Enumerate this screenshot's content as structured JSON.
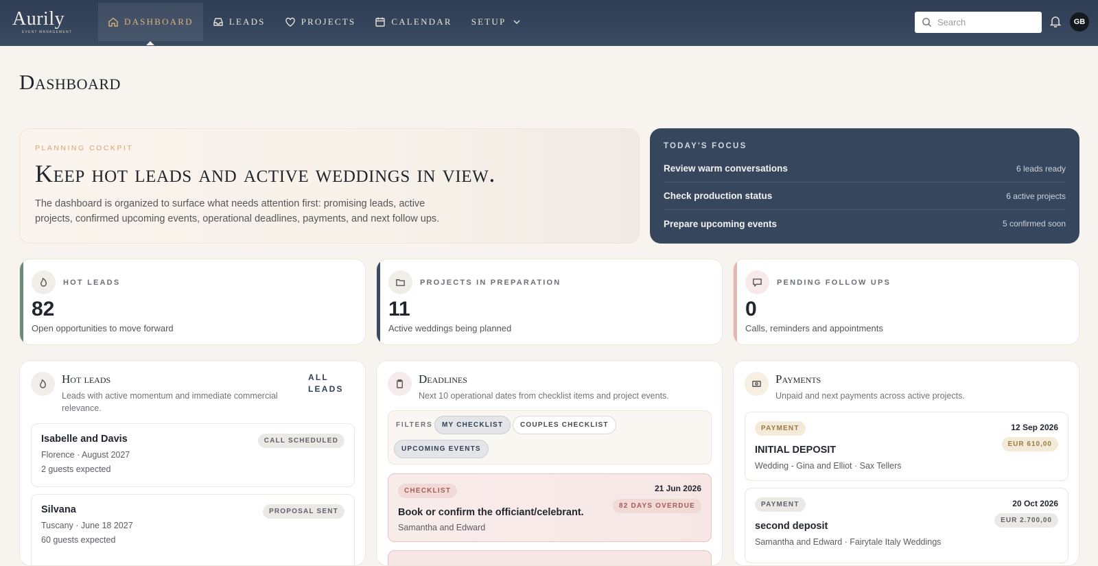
{
  "nav": {
    "logo": "Aurily",
    "logo_sub": "EVENT MANAGEMENT",
    "items": [
      {
        "label": "Dashboard",
        "icon": "home-icon"
      },
      {
        "label": "Leads",
        "icon": "inbox-icon"
      },
      {
        "label": "Projects",
        "icon": "heart-icon"
      },
      {
        "label": "Calendar",
        "icon": "calendar-icon"
      },
      {
        "label": "Setup",
        "icon": "chevron-down-icon"
      }
    ],
    "search_placeholder": "Search",
    "avatar": "GB"
  },
  "page": {
    "title": "Dashboard"
  },
  "hero": {
    "eyebrow": "Planning cockpit",
    "title": "Keep hot leads and active weddings in view.",
    "text": "The dashboard is organized to surface what needs attention first: promising leads, active projects, confirmed upcoming events, operational deadlines, payments, and next follow ups."
  },
  "focus": {
    "label": "Today's focus",
    "rows": [
      {
        "title": "Review warm conversations",
        "meta": "6 leads ready"
      },
      {
        "title": "Check production status",
        "meta": "6 active projects"
      },
      {
        "title": "Prepare upcoming events",
        "meta": "5 confirmed soon"
      }
    ]
  },
  "stats": [
    {
      "label": "Hot leads",
      "value": "82",
      "sub": "Open opportunities to move forward"
    },
    {
      "label": "Projects in preparation",
      "value": "11",
      "sub": "Active weddings being planned"
    },
    {
      "label": "Pending follow ups",
      "value": "0",
      "sub": "Calls, reminders and appointments"
    }
  ],
  "hot_leads": {
    "title": "Hot leads",
    "sub": "Leads with active momentum and immediate commercial relevance.",
    "action_line1": "All",
    "action_line2": "leads",
    "items": [
      {
        "name": "Isabelle and Davis",
        "place": "Florence · August 2027",
        "guests": "2 guests expected",
        "status": "Call scheduled"
      },
      {
        "name": "Silvana",
        "place": "Tuscany · June 18 2027",
        "guests": "60 guests expected",
        "status": "Proposal sent"
      }
    ]
  },
  "deadlines": {
    "title": "Deadlines",
    "sub": "Next 10 operational dates from checklist items and project events.",
    "filters_label": "Filters",
    "filters": [
      "My checklist",
      "Couples checklist",
      "Upcoming events"
    ],
    "items": [
      {
        "tag": "Checklist",
        "date": "21 Jun 2026",
        "overdue": "82 days overdue",
        "title": "Book or confirm the officiant/celebrant.",
        "who": "Samantha and Edward"
      }
    ]
  },
  "payments": {
    "title": "Payments",
    "sub": "Unpaid and next payments across active projects.",
    "items": [
      {
        "tag": "Payment",
        "date": "12 Sep 2026",
        "amount": "EUR 610,00",
        "title": "INITIAL DEPOSIT",
        "sub": "Wedding - Gina and Elliot · Sax Tellers"
      },
      {
        "tag": "Payment",
        "date": "20 Oct 2026",
        "amount": "EUR 2.700,00",
        "title": "second deposit",
        "sub": "Samantha and Edward · Fairytale Italy Weddings"
      }
    ]
  },
  "colors": {
    "nav_bg": "#34445b",
    "accent_gold": "#d9b27a",
    "focus_bg": "#35465d",
    "overdue": "#a55b55"
  }
}
